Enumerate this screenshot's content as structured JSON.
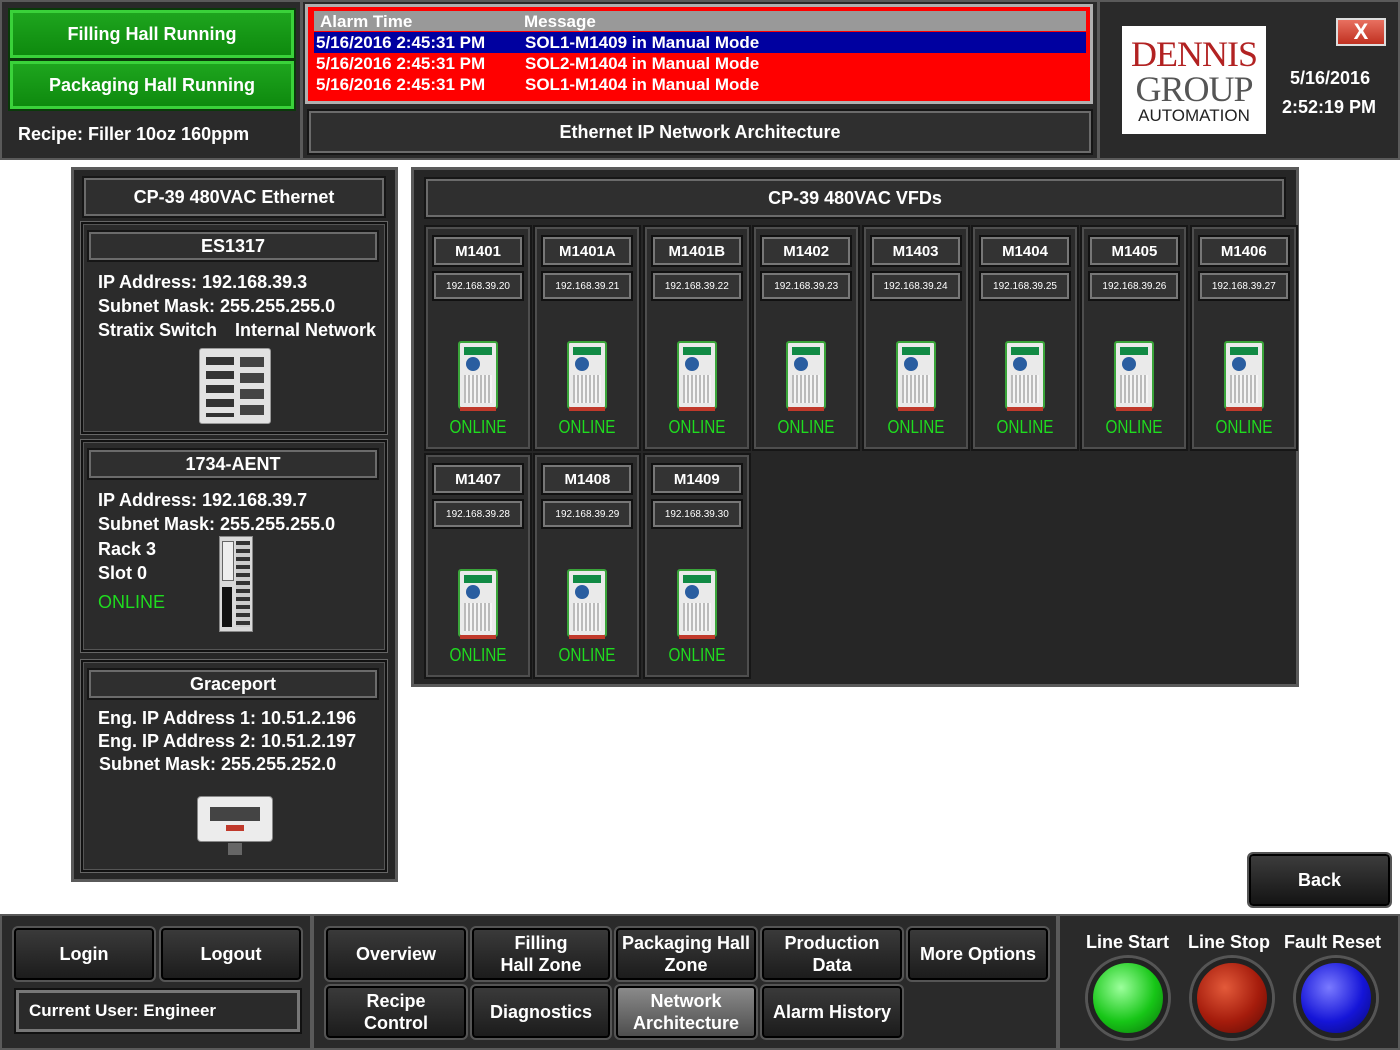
{
  "header": {
    "status_filling": "Filling Hall Running",
    "status_packaging": "Packaging Hall Running",
    "recipe": "Recipe: Filler 10oz 160ppm",
    "screen_title": "Ethernet IP Network Architecture",
    "date": "5/16/2016",
    "time": "2:52:19 PM",
    "logo_line1": "DENNIS",
    "logo_line2": "GROUP",
    "logo_line3": "AUTOMATION",
    "close_label": "X"
  },
  "alarms": {
    "col_time": "Alarm Time",
    "col_message": "Message",
    "rows": [
      {
        "time": "5/16/2016 2:45:31 PM",
        "message": "SOL1-M1409 in Manual Mode",
        "color": "#0000a0"
      },
      {
        "time": "5/16/2016 2:45:31 PM",
        "message": "SOL2-M1404 in Manual Mode",
        "color": "#ff0000"
      },
      {
        "time": "5/16/2016 2:45:31 PM",
        "message": "SOL1-M1404 in Manual Mode",
        "color": "#ff0000"
      }
    ]
  },
  "ethernet_panel": {
    "title": "CP-39 480VAC Ethernet",
    "switch": {
      "name": "ES1317",
      "ip": "IP Address: 192.168.39.3",
      "subnet": "Subnet Mask: 255.255.255.0",
      "type": "Stratix Switch",
      "network": "Internal Network"
    },
    "adapter": {
      "name": "1734-AENT",
      "ip": "IP Address: 192.168.39.7",
      "subnet": "Subnet Mask: 255.255.255.0",
      "rack": "Rack 3",
      "slot": "Slot 0",
      "status": "ONLINE"
    },
    "gateway": {
      "name": "Graceport",
      "ip1": "Eng. IP Address 1: 10.51.2.196",
      "ip2": "Eng. IP Address 2: 10.51.2.197",
      "subnet": "Subnet Mask: 255.255.252.0"
    }
  },
  "vfd_panel": {
    "title": "CP-39 480VAC VFDs",
    "drives": [
      {
        "name": "M1401",
        "ip": "192.168.39.20",
        "status": "ONLINE"
      },
      {
        "name": "M1401A",
        "ip": "192.168.39.21",
        "status": "ONLINE"
      },
      {
        "name": "M1401B",
        "ip": "192.168.39.22",
        "status": "ONLINE"
      },
      {
        "name": "M1402",
        "ip": "192.168.39.23",
        "status": "ONLINE"
      },
      {
        "name": "M1403",
        "ip": "192.168.39.24",
        "status": "ONLINE"
      },
      {
        "name": "M1404",
        "ip": "192.168.39.25",
        "status": "ONLINE"
      },
      {
        "name": "M1405",
        "ip": "192.168.39.26",
        "status": "ONLINE"
      },
      {
        "name": "M1406",
        "ip": "192.168.39.27",
        "status": "ONLINE"
      },
      {
        "name": "M1407",
        "ip": "192.168.39.28",
        "status": "ONLINE"
      },
      {
        "name": "M1408",
        "ip": "192.168.39.29",
        "status": "ONLINE"
      },
      {
        "name": "M1409",
        "ip": "192.168.39.30",
        "status": "ONLINE"
      }
    ]
  },
  "back_label": "Back",
  "footer": {
    "login": "Login",
    "logout": "Logout",
    "current_user": "Current User: Engineer",
    "nav": {
      "overview": "Overview",
      "filling_zone": "Filling Hall Zone",
      "packaging_zone": "Packaging Hall Zone",
      "production_data": "Production Data",
      "more_options": "More Options",
      "recipe_control": "Recipe Control",
      "diagnostics": "Diagnostics",
      "network_architecture": "Network Architecture",
      "alarm_history": "Alarm History"
    },
    "line_start": "Line Start",
    "line_stop": "Line Stop",
    "fault_reset": "Fault Reset"
  },
  "colors": {
    "running_green": "#129a12",
    "online_green": "#1fdc1f",
    "alarm_red": "#ff0000",
    "alarm_selected": "#0000a0"
  }
}
